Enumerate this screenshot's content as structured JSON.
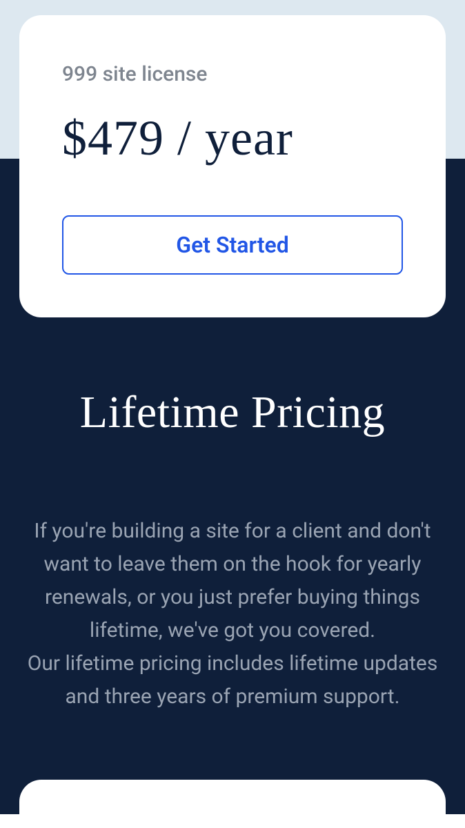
{
  "card": {
    "license_label": "999 site license",
    "price": "$479 / year",
    "cta_label": "Get Started"
  },
  "lifetime": {
    "heading": "Lifetime Pricing",
    "body_line1": "If you're building a site for a client and don't want to leave them on the hook for yearly renewals, or you just prefer buying things lifetime, we've got you covered.",
    "body_line2": "Our lifetime pricing includes lifetime updates and three years of premium support."
  }
}
